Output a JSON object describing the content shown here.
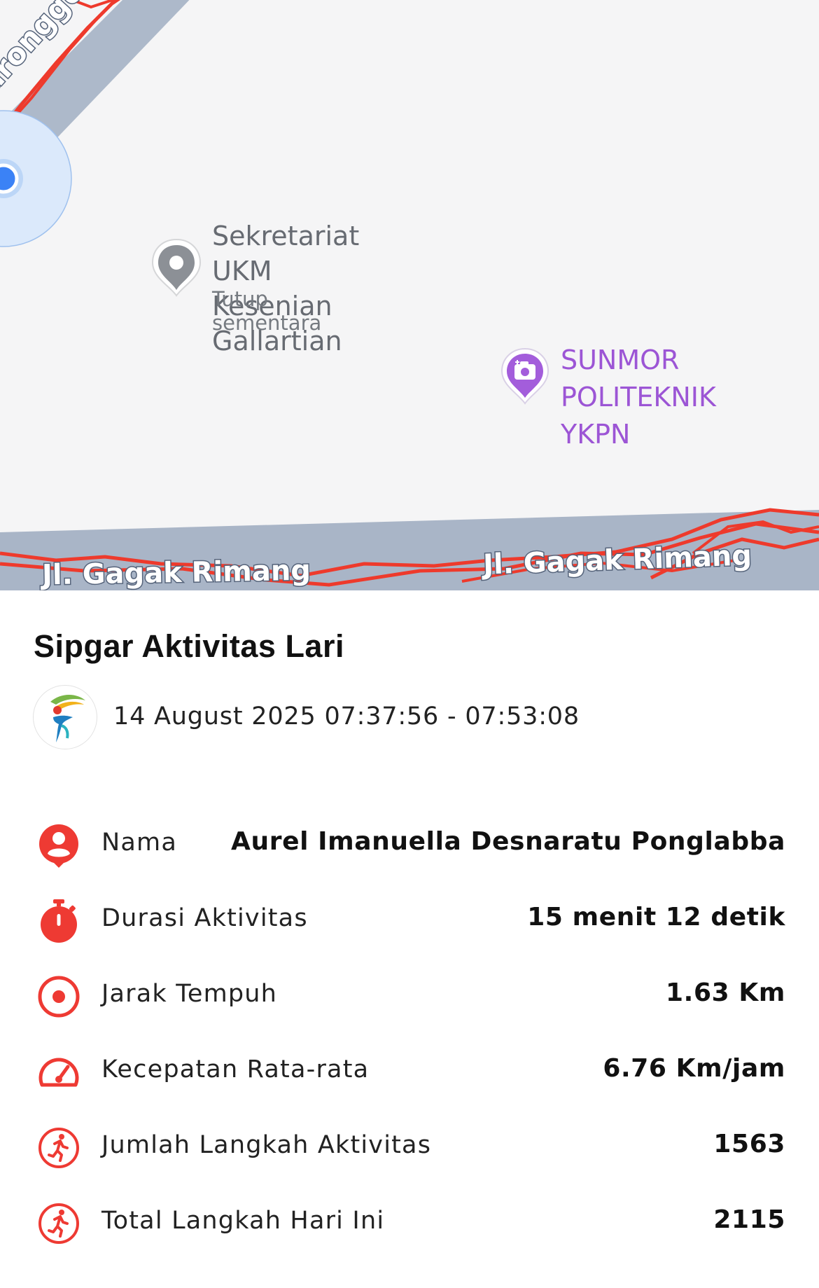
{
  "map": {
    "road_diagonal": "uronggo Seto",
    "road_bottom_left": "Jl. Gagak Rimang",
    "road_bottom_right": "Jl. Gagak Rimang",
    "poi_gray": {
      "name_line1": "Sekretariat UKM",
      "name_line2": "Kesenian Gallartian",
      "status": "Tutup sementara",
      "icon": "location-pin-icon"
    },
    "poi_purple": {
      "name_line1": "SUNMOR",
      "name_line2": "POLITEKNIK YKPN",
      "icon": "camera-pin-icon"
    },
    "colors": {
      "track": "#ee3a2c",
      "road": "#a9b5c7",
      "poi_purple": "#9c55d5",
      "location": "#3b82f6"
    }
  },
  "activity": {
    "title": "Sipgar Aktivitas Lari",
    "datetime": "14 August 2025 07:37:56 - 07:53:08",
    "rows": [
      {
        "icon": "user-icon",
        "label": "Nama",
        "value": "Aurel Imanuella Desnaratu Ponglabba"
      },
      {
        "icon": "stopwatch-icon",
        "label": "Durasi Aktivitas",
        "value": "15 menit 12 detik"
      },
      {
        "icon": "target-icon",
        "label": "Jarak Tempuh",
        "value": "1.63 Km"
      },
      {
        "icon": "speedometer-icon",
        "label": "Kecepatan Rata-rata",
        "value": "6.76 Km/jam"
      },
      {
        "icon": "runner-icon",
        "label": "Jumlah Langkah Aktivitas",
        "value": "1563"
      },
      {
        "icon": "runner-icon",
        "label": "Total Langkah Hari Ini",
        "value": "2115"
      }
    ],
    "accent_color": "#ee3a33"
  }
}
